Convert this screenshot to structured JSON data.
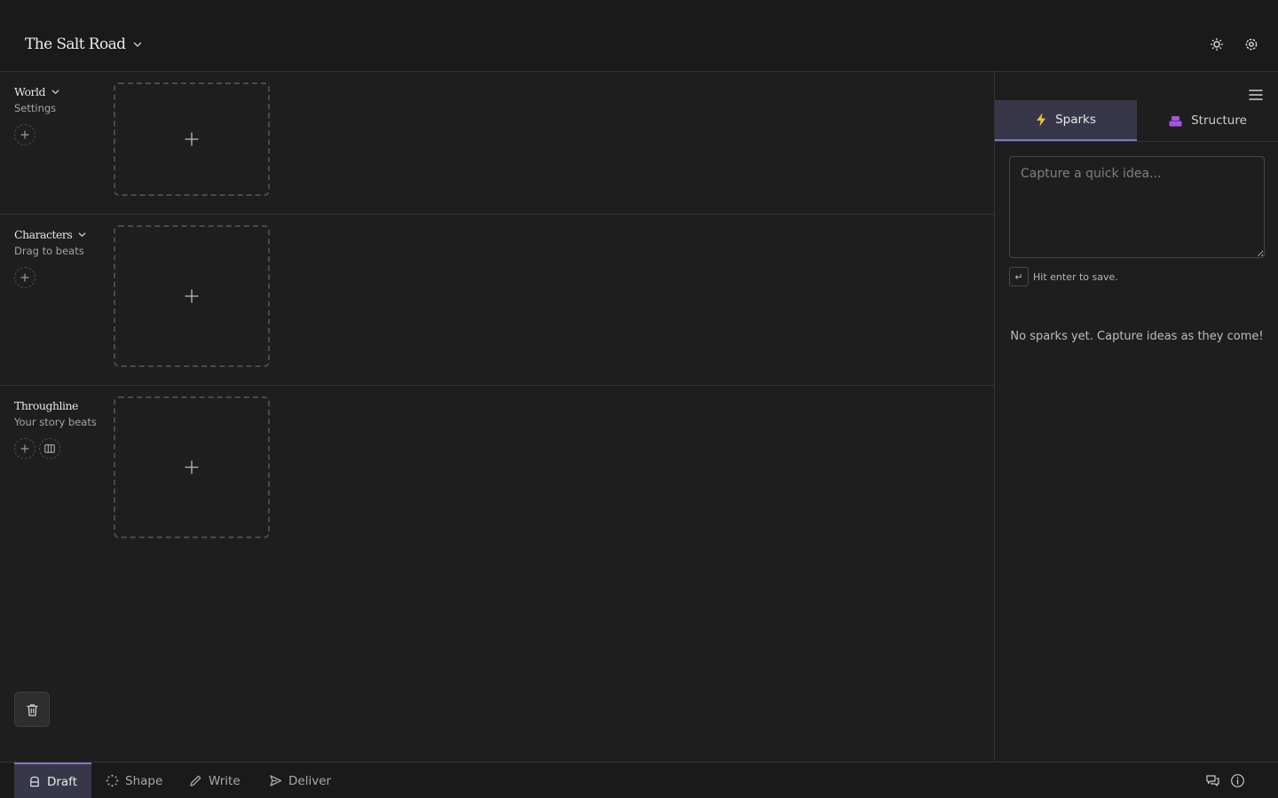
{
  "header": {
    "project_title": "The Salt Road",
    "icons": [
      "theme-sun-icon",
      "settings-gear-icon"
    ]
  },
  "lanes": [
    {
      "title": "World",
      "subtitle": "Settings",
      "collapsible": true
    },
    {
      "title": "Characters",
      "subtitle": "Drag to beats",
      "collapsible": true
    },
    {
      "title": "Throughline",
      "subtitle": "Your story beats",
      "collapsible": false
    }
  ],
  "panel": {
    "tabs": [
      {
        "label": "Sparks",
        "icon": "lightning-icon",
        "active": true,
        "color": "#f2c230"
      },
      {
        "label": "Structure",
        "icon": "bricks-icon",
        "active": false,
        "color": "#a357e0"
      }
    ],
    "input_placeholder": "Capture a quick idea...",
    "hint_key": "↵",
    "hint_text": "Hit enter to save.",
    "empty_message": "No sparks yet. Capture ideas as they come!"
  },
  "bottom_bar": {
    "modes": [
      {
        "label": "Draft",
        "icon": "draft-icon",
        "active": true
      },
      {
        "label": "Shape",
        "icon": "shape-icon",
        "active": false
      },
      {
        "label": "Write",
        "icon": "pencil-icon",
        "active": false
      },
      {
        "label": "Deliver",
        "icon": "send-icon",
        "active": false
      }
    ],
    "right_icons": [
      "feedback-chat-icon",
      "info-icon"
    ]
  },
  "colors": {
    "accent": "#7a78c9",
    "active_tab_bg": "#373749",
    "background": "#1e1e1e"
  }
}
